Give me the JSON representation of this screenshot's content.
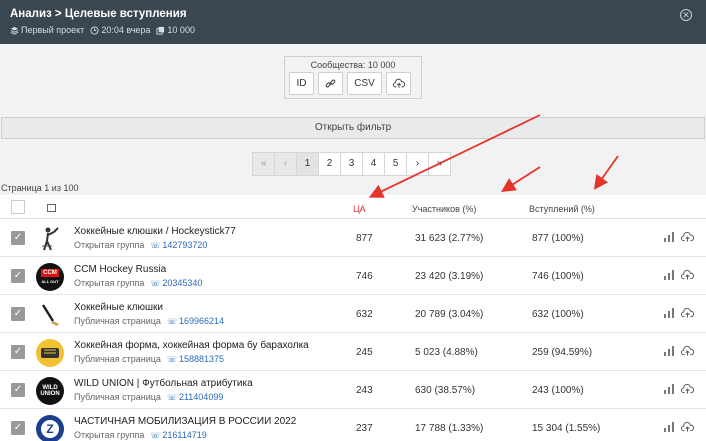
{
  "header": {
    "title": "Анализ > Целевые вступления",
    "project": "Первый проект",
    "time": "20:04 вчера",
    "count": "10 000"
  },
  "export": {
    "label": "Сообщества: 10 000",
    "id_label": "ID",
    "csv_label": "CSV"
  },
  "filter_label": "Открыть фильтр",
  "pagination": {
    "first": "«",
    "prev": "‹",
    "pages": [
      "1",
      "2",
      "3",
      "4",
      "5"
    ],
    "next": "›",
    "last": "»",
    "active": "1"
  },
  "page_info": "Страница 1 из 100",
  "table": {
    "headers": {
      "ca": "ЦА",
      "members": "Участников (%)",
      "joins": "Вступлений (%)"
    },
    "rows": [
      {
        "name": "Хоккейные клюшки / Hockeystick77",
        "type": "Открытая группа",
        "id": "142793720",
        "ca": "877",
        "members": "31 623 (2.77%)",
        "joins": "877 (100%)",
        "logo": "stick-player"
      },
      {
        "name": "CCM Hockey Russia",
        "type": "Открытая группа",
        "id": "20345340",
        "ca": "746",
        "members": "23 420 (3.19%)",
        "joins": "746 (100%)",
        "logo": "ccm",
        "logo_text": "CCM",
        "logo_sub": "ALL OUT"
      },
      {
        "name": "Хоккейные клюшки",
        "type": "Публичная страница",
        "id": "169966214",
        "ca": "632",
        "members": "20 789 (3.04%)",
        "joins": "632 (100%)",
        "logo": "hockey-stick"
      },
      {
        "name": "Хоккейная форма, хоккейная форма бу барахолка",
        "type": "Публичная страница",
        "id": "158881375",
        "ca": "245",
        "members": "5 023 (4.88%)",
        "joins": "259 (94.59%)",
        "logo": "jersey-badge"
      },
      {
        "name": "WILD UNION | Футбольная атрибутика",
        "type": "Публичная страница",
        "id": "211404099",
        "ca": "243",
        "members": "630 (38.57%)",
        "joins": "243 (100%)",
        "logo": "wild-union",
        "logo_text": "WILD UNION"
      },
      {
        "name": "ЧАСТИЧНАЯ МОБИЛИЗАЦИЯ В РОССИИ 2022",
        "type": "Открытая группа",
        "id": "216114719",
        "ca": "237",
        "members": "17 788 (1.33%)",
        "joins": "15 304 (1.55%)",
        "logo": "z-badge",
        "logo_text": "Z"
      }
    ]
  },
  "colors": {
    "topbar": "#3a4750",
    "accent_red": "#e03030",
    "link": "#2a6bb5",
    "checkbox": "#999999"
  }
}
